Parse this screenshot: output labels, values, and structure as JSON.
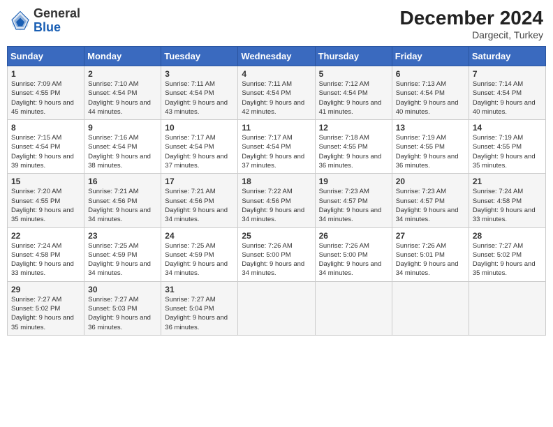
{
  "header": {
    "logo": {
      "line1": "General",
      "line2": "Blue"
    },
    "title": "December 2024",
    "location": "Dargecit, Turkey"
  },
  "weekdays": [
    "Sunday",
    "Monday",
    "Tuesday",
    "Wednesday",
    "Thursday",
    "Friday",
    "Saturday"
  ],
  "weeks": [
    [
      {
        "day": "1",
        "sunrise": "7:09 AM",
        "sunset": "4:55 PM",
        "daylight": "9 hours and 45 minutes."
      },
      {
        "day": "2",
        "sunrise": "7:10 AM",
        "sunset": "4:54 PM",
        "daylight": "9 hours and 44 minutes."
      },
      {
        "day": "3",
        "sunrise": "7:11 AM",
        "sunset": "4:54 PM",
        "daylight": "9 hours and 43 minutes."
      },
      {
        "day": "4",
        "sunrise": "7:11 AM",
        "sunset": "4:54 PM",
        "daylight": "9 hours and 42 minutes."
      },
      {
        "day": "5",
        "sunrise": "7:12 AM",
        "sunset": "4:54 PM",
        "daylight": "9 hours and 41 minutes."
      },
      {
        "day": "6",
        "sunrise": "7:13 AM",
        "sunset": "4:54 PM",
        "daylight": "9 hours and 40 minutes."
      },
      {
        "day": "7",
        "sunrise": "7:14 AM",
        "sunset": "4:54 PM",
        "daylight": "9 hours and 40 minutes."
      }
    ],
    [
      {
        "day": "8",
        "sunrise": "7:15 AM",
        "sunset": "4:54 PM",
        "daylight": "9 hours and 39 minutes."
      },
      {
        "day": "9",
        "sunrise": "7:16 AM",
        "sunset": "4:54 PM",
        "daylight": "9 hours and 38 minutes."
      },
      {
        "day": "10",
        "sunrise": "7:17 AM",
        "sunset": "4:54 PM",
        "daylight": "9 hours and 37 minutes."
      },
      {
        "day": "11",
        "sunrise": "7:17 AM",
        "sunset": "4:54 PM",
        "daylight": "9 hours and 37 minutes."
      },
      {
        "day": "12",
        "sunrise": "7:18 AM",
        "sunset": "4:55 PM",
        "daylight": "9 hours and 36 minutes."
      },
      {
        "day": "13",
        "sunrise": "7:19 AM",
        "sunset": "4:55 PM",
        "daylight": "9 hours and 36 minutes."
      },
      {
        "day": "14",
        "sunrise": "7:19 AM",
        "sunset": "4:55 PM",
        "daylight": "9 hours and 35 minutes."
      }
    ],
    [
      {
        "day": "15",
        "sunrise": "7:20 AM",
        "sunset": "4:55 PM",
        "daylight": "9 hours and 35 minutes."
      },
      {
        "day": "16",
        "sunrise": "7:21 AM",
        "sunset": "4:56 PM",
        "daylight": "9 hours and 34 minutes."
      },
      {
        "day": "17",
        "sunrise": "7:21 AM",
        "sunset": "4:56 PM",
        "daylight": "9 hours and 34 minutes."
      },
      {
        "day": "18",
        "sunrise": "7:22 AM",
        "sunset": "4:56 PM",
        "daylight": "9 hours and 34 minutes."
      },
      {
        "day": "19",
        "sunrise": "7:23 AM",
        "sunset": "4:57 PM",
        "daylight": "9 hours and 34 minutes."
      },
      {
        "day": "20",
        "sunrise": "7:23 AM",
        "sunset": "4:57 PM",
        "daylight": "9 hours and 34 minutes."
      },
      {
        "day": "21",
        "sunrise": "7:24 AM",
        "sunset": "4:58 PM",
        "daylight": "9 hours and 33 minutes."
      }
    ],
    [
      {
        "day": "22",
        "sunrise": "7:24 AM",
        "sunset": "4:58 PM",
        "daylight": "9 hours and 33 minutes."
      },
      {
        "day": "23",
        "sunrise": "7:25 AM",
        "sunset": "4:59 PM",
        "daylight": "9 hours and 34 minutes."
      },
      {
        "day": "24",
        "sunrise": "7:25 AM",
        "sunset": "4:59 PM",
        "daylight": "9 hours and 34 minutes."
      },
      {
        "day": "25",
        "sunrise": "7:26 AM",
        "sunset": "5:00 PM",
        "daylight": "9 hours and 34 minutes."
      },
      {
        "day": "26",
        "sunrise": "7:26 AM",
        "sunset": "5:00 PM",
        "daylight": "9 hours and 34 minutes."
      },
      {
        "day": "27",
        "sunrise": "7:26 AM",
        "sunset": "5:01 PM",
        "daylight": "9 hours and 34 minutes."
      },
      {
        "day": "28",
        "sunrise": "7:27 AM",
        "sunset": "5:02 PM",
        "daylight": "9 hours and 35 minutes."
      }
    ],
    [
      {
        "day": "29",
        "sunrise": "7:27 AM",
        "sunset": "5:02 PM",
        "daylight": "9 hours and 35 minutes."
      },
      {
        "day": "30",
        "sunrise": "7:27 AM",
        "sunset": "5:03 PM",
        "daylight": "9 hours and 36 minutes."
      },
      {
        "day": "31",
        "sunrise": "7:27 AM",
        "sunset": "5:04 PM",
        "daylight": "9 hours and 36 minutes."
      },
      null,
      null,
      null,
      null
    ]
  ]
}
